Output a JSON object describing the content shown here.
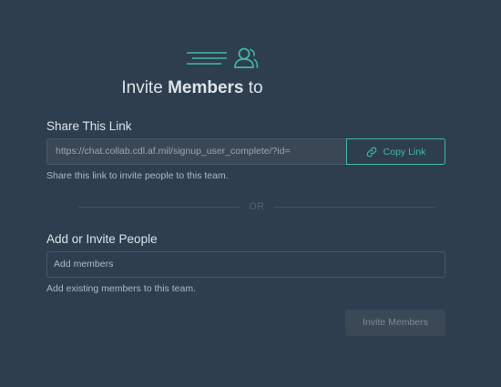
{
  "header": {
    "title_prefix": "Invite",
    "title_strong": "Members",
    "title_suffix": "to",
    "icon": "invite-members-icon"
  },
  "share_section": {
    "label": "Share This Link",
    "link_value": "https://chat.collab.cdl.af.mil/signup_user_complete/?id=",
    "copy_button_label": "Copy Link",
    "copy_icon": "link-icon",
    "help_text": "Share this link to invite people to this team."
  },
  "divider": {
    "text": "OR"
  },
  "invite_section": {
    "label": "Add or Invite People",
    "placeholder": "Add members",
    "help_text": "Add existing members to this team."
  },
  "actions": {
    "invite_button_label": "Invite Members",
    "invite_button_enabled": false
  },
  "colors": {
    "background": "#2f3e4e",
    "accent": "#3fb9a7",
    "text": "#dde3ea",
    "muted": "#aeb8c2"
  }
}
